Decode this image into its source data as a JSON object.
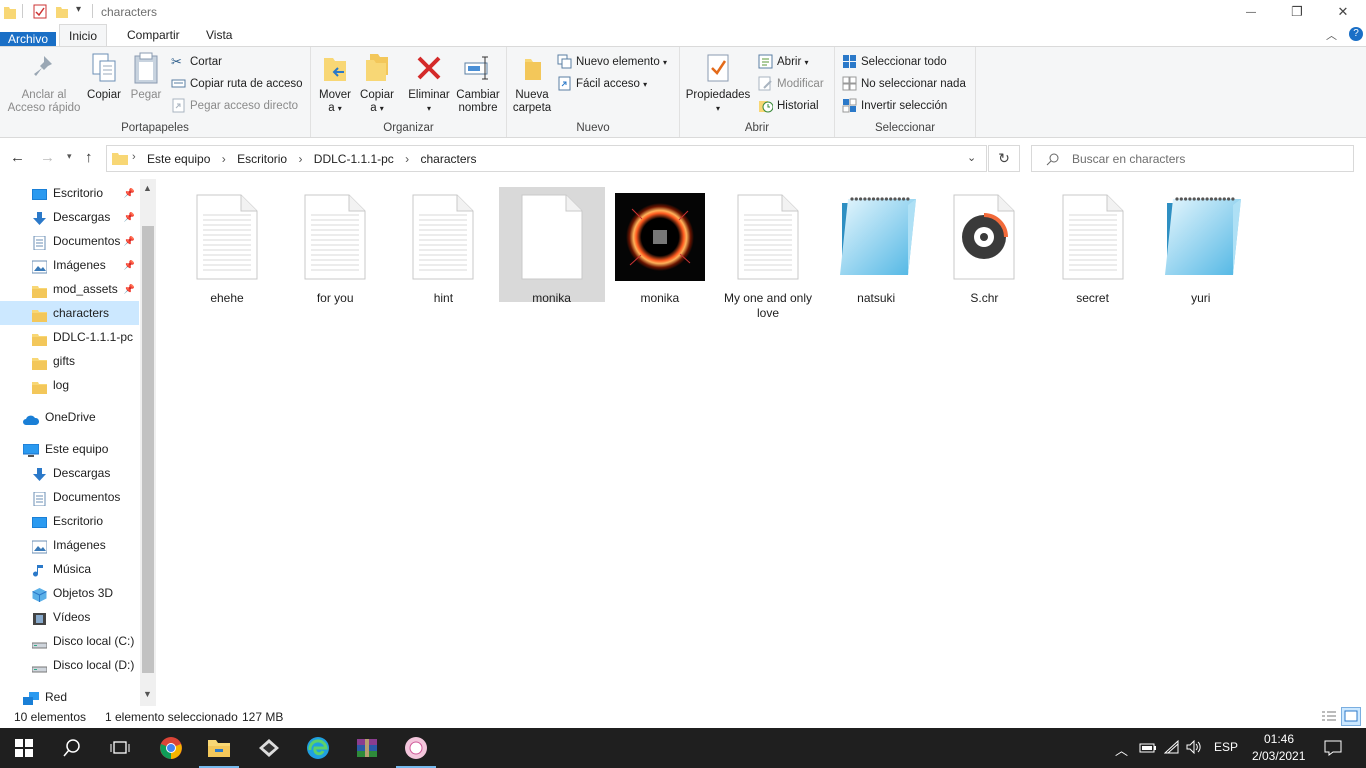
{
  "window": {
    "title": "characters",
    "minimize_glyph": "—",
    "maximize_glyph": "❐",
    "close_glyph": "✕"
  },
  "ribbon_tabs": {
    "file": "Archivo",
    "home": "Inicio",
    "share": "Compartir",
    "view": "Vista"
  },
  "ribbon": {
    "clipboard": {
      "label": "Portapapeles",
      "pin": "Anclar al Acceso rápido",
      "copy": "Copiar",
      "paste": "Pegar",
      "cut": "Cortar",
      "copy_path": "Copiar ruta de acceso",
      "paste_shortcut": "Pegar acceso directo"
    },
    "organize": {
      "label": "Organizar",
      "move": "Mover a",
      "copy_to": "Copiar a",
      "delete": "Eliminar",
      "rename": "Cambiar nombre"
    },
    "new": {
      "label": "Nuevo",
      "new_folder": "Nueva carpeta",
      "new_item": "Nuevo elemento",
      "easy_access": "Fácil acceso"
    },
    "open": {
      "label": "Abrir",
      "properties": "Propiedades",
      "open": "Abrir",
      "edit": "Modificar",
      "history": "Historial"
    },
    "select": {
      "label": "Seleccionar",
      "select_all": "Seleccionar todo",
      "select_none": "No seleccionar nada",
      "invert": "Invertir selección"
    }
  },
  "address": {
    "crumbs": [
      "Este equipo",
      "Escritorio",
      "DDLC-1.1.1-pc",
      "characters"
    ],
    "search_placeholder": "Buscar en characters"
  },
  "nav": {
    "quick": [
      {
        "label": "Escritorio",
        "icon": "desktop-icon",
        "pinned": true
      },
      {
        "label": "Descargas",
        "icon": "download-icon",
        "pinned": true
      },
      {
        "label": "Documentos",
        "icon": "document-icon",
        "pinned": true
      },
      {
        "label": "Imágenes",
        "icon": "pictures-icon",
        "pinned": true
      },
      {
        "label": "mod_assets",
        "icon": "folder-icon",
        "pinned": true
      },
      {
        "label": "characters",
        "icon": "folder-icon",
        "pinned": false,
        "selected": true
      },
      {
        "label": "DDLC-1.1.1-pc",
        "icon": "folder-icon",
        "pinned": false
      },
      {
        "label": "gifts",
        "icon": "folder-icon",
        "pinned": false
      },
      {
        "label": "log",
        "icon": "folder-icon",
        "pinned": false
      }
    ],
    "onedrive": "OneDrive",
    "this_pc": "Este equipo",
    "pc_items": [
      {
        "label": "Descargas",
        "icon": "download-icon"
      },
      {
        "label": "Documentos",
        "icon": "document-icon"
      },
      {
        "label": "Escritorio",
        "icon": "desktop-icon"
      },
      {
        "label": "Imágenes",
        "icon": "pictures-icon"
      },
      {
        "label": "Música",
        "icon": "music-icon"
      },
      {
        "label": "Objetos 3D",
        "icon": "3d-objects-icon"
      },
      {
        "label": "Vídeos",
        "icon": "video-icon"
      },
      {
        "label": "Disco local (C:)",
        "icon": "drive-icon"
      },
      {
        "label": "Disco local (D:)",
        "icon": "drive-icon"
      }
    ],
    "network": "Red"
  },
  "files": [
    {
      "name": "ehehe",
      "type": "text-file"
    },
    {
      "name": "for you",
      "type": "text-file"
    },
    {
      "name": "hint",
      "type": "text-file"
    },
    {
      "name": "monika",
      "type": "blank-file",
      "selected": true
    },
    {
      "name": "monika",
      "type": "image-thumbnail"
    },
    {
      "name": "My one and only love",
      "type": "text-file"
    },
    {
      "name": "natsuki",
      "type": "notepad-file"
    },
    {
      "name": "S.chr",
      "type": "media-file"
    },
    {
      "name": "secret",
      "type": "text-file"
    },
    {
      "name": "yuri",
      "type": "notepad-file"
    }
  ],
  "status": {
    "count": "10 elementos",
    "selection": "1 elemento seleccionado",
    "size": "127 MB"
  },
  "taskbar": {
    "apps": [
      "start-icon",
      "search-icon",
      "task-view-icon",
      "chrome-icon",
      "file-explorer-icon",
      "app-icon",
      "edge-icon",
      "winrar-icon",
      "game-icon"
    ],
    "language": "ESP",
    "time": "01:46",
    "date": "2/03/2021"
  }
}
